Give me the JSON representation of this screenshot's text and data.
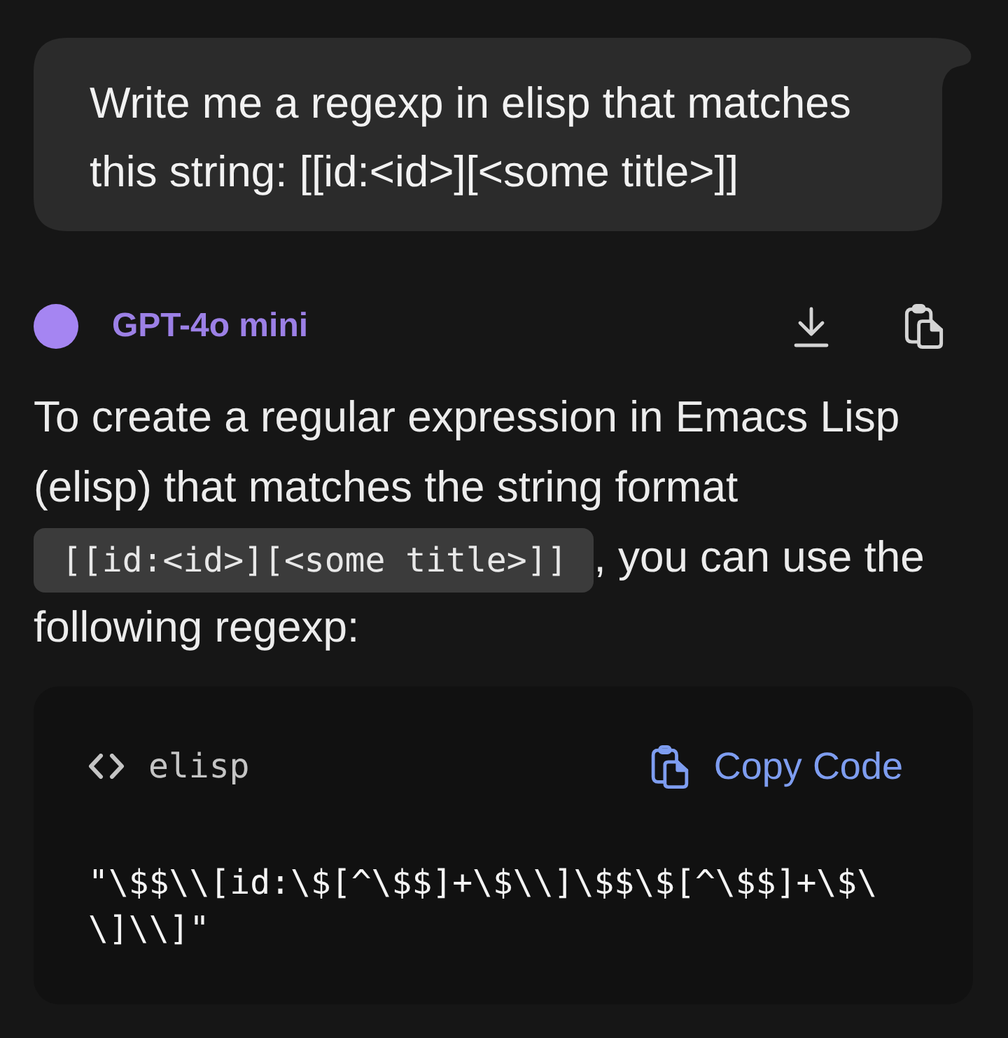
{
  "user_message": {
    "text": "Write me a regexp in elisp that matches this string: [[id:<id>][<some title>]]"
  },
  "response": {
    "model": "GPT-4o mini",
    "segments": [
      {
        "kind": "text",
        "text": "To create a regular expression in Emacs Lisp (elisp) that matches the string format "
      },
      {
        "kind": "code",
        "text": "[[id:<id>][<some title>]]"
      },
      {
        "kind": "text",
        "text": ", you can use the following regexp:"
      }
    ],
    "code_block": {
      "language": "elisp",
      "copy_label": "Copy Code",
      "code": "\"\\$$\\\\[id:\\$[^\\$$]+\\$\\\\]\\$$\\$[^\\$$]+\\$\\\\]\\\\]\""
    }
  }
}
